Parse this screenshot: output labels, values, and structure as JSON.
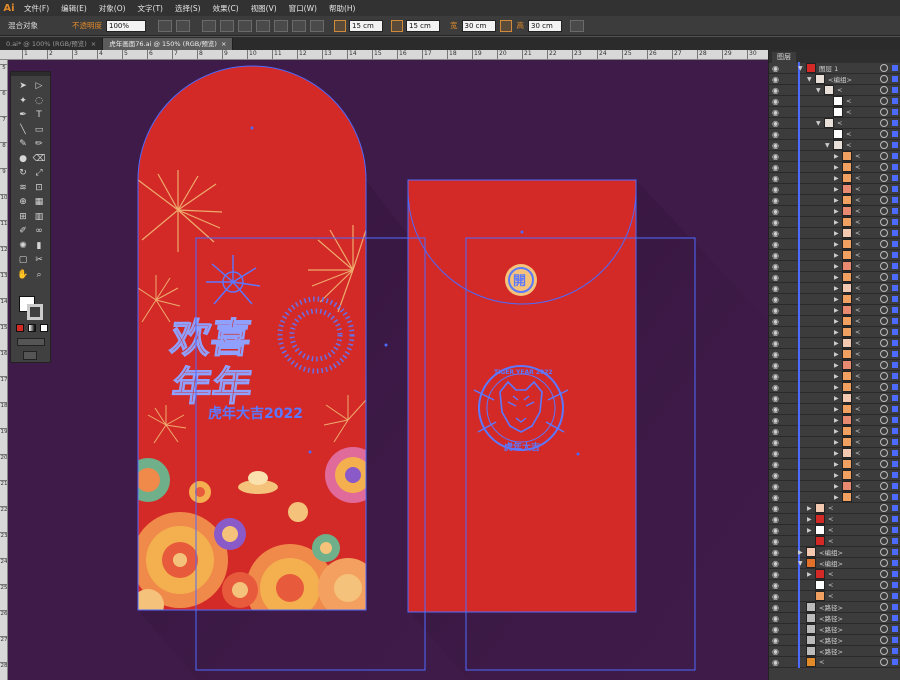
{
  "app": {
    "logo": "Ai"
  },
  "menu": [
    "文件(F)",
    "编辑(E)",
    "对象(O)",
    "文字(T)",
    "选择(S)",
    "效果(C)",
    "视图(V)",
    "窗口(W)",
    "帮助(H)"
  ],
  "control_bar": {
    "mode_label": "混合对象",
    "opacity_label": "不透明度",
    "opacity_value": "100%",
    "w_label": "宽",
    "x_value": "15 cm",
    "y_value": "15 cm",
    "w_value": "30 cm",
    "h_label": "高",
    "h_value": "30 cm"
  },
  "tabs": [
    {
      "label": "0.ai* @ 100% (RGB/预览)",
      "close": "×",
      "active": false
    },
    {
      "label": "虎年画面76.ai @ 150% (RGB/预览)",
      "close": "×",
      "active": true
    }
  ],
  "ruler_top": [
    "1",
    "2",
    "3",
    "4",
    "5",
    "6",
    "7",
    "8",
    "9",
    "10",
    "11",
    "12",
    "13",
    "14",
    "15",
    "16",
    "17",
    "18",
    "19",
    "20",
    "21",
    "22",
    "23",
    "24",
    "25",
    "26",
    "27",
    "28",
    "29",
    "30",
    "31"
  ],
  "ruler_left": [
    "5",
    "6",
    "7",
    "8",
    "9",
    "10",
    "11",
    "12",
    "13",
    "14",
    "15",
    "16",
    "17",
    "18",
    "19",
    "20",
    "21",
    "22",
    "23",
    "24",
    "25",
    "26",
    "27",
    "28"
  ],
  "artwork": {
    "title_line1": "欢喜",
    "title_line2": "年年",
    "badge_year": "虎年大吉2022",
    "seal_char": "開",
    "tiger_badge_top": "TIGER YEAR 2022",
    "tiger_badge_bottom": "虎年大吉",
    "colors": {
      "red": "#d32a27",
      "purple": "#3f1b49",
      "gold": "#f4c27a",
      "blue": "#5c78ff",
      "selection": "#4d6aff"
    }
  },
  "toolbox": {
    "icons": [
      "selection-icon",
      "direct-select-icon",
      "magic-wand-icon",
      "lasso-icon",
      "pen-icon",
      "type-icon",
      "line-icon",
      "rect-icon",
      "brush-icon",
      "pencil-icon",
      "blob-brush-icon",
      "eraser-icon",
      "rotate-icon",
      "scale-icon",
      "width-icon",
      "free-transform-icon",
      "shape-builder-icon",
      "perspective-icon",
      "mesh-icon",
      "gradient-icon",
      "eyedropper-icon",
      "blend-icon",
      "symbol-sprayer-icon",
      "graph-icon",
      "artboard-icon",
      "slice-icon",
      "hand-icon",
      "zoom-icon"
    ]
  },
  "layers": {
    "panel_title": "图层",
    "rows": [
      {
        "name": "图层 1",
        "indent": 1,
        "tri": "▼",
        "thumb": "#d32a27"
      },
      {
        "name": "<编组>",
        "indent": 2,
        "tri": "▼",
        "thumb": "#e8e0d8"
      },
      {
        "name": "<",
        "indent": 3,
        "tri": "▼",
        "thumb": "#e8e0d8"
      },
      {
        "name": "<",
        "indent": 4,
        "tri": "",
        "thumb": "#ffffff"
      },
      {
        "name": "<",
        "indent": 4,
        "tri": "",
        "thumb": "#ffffff"
      },
      {
        "name": "<",
        "indent": 3,
        "tri": "▼",
        "thumb": "#e8e0d8"
      },
      {
        "name": "<",
        "indent": 4,
        "tri": "",
        "thumb": "#ffffff"
      },
      {
        "name": "<",
        "indent": 4,
        "tri": "▼",
        "thumb": "#e8e0d8"
      },
      {
        "name": "<",
        "indent": 5,
        "tri": "▶",
        "thumb": "#f0a060"
      },
      {
        "name": "<",
        "indent": 5,
        "tri": "▶",
        "thumb": "#f0a060"
      },
      {
        "name": "<",
        "indent": 5,
        "tri": "▶",
        "thumb": "#f0a060"
      },
      {
        "name": "<",
        "indent": 5,
        "tri": "▶",
        "thumb": "#e88a70"
      },
      {
        "name": "<",
        "indent": 5,
        "tri": "▶",
        "thumb": "#f0a060"
      },
      {
        "name": "<",
        "indent": 5,
        "tri": "▶",
        "thumb": "#e88a70"
      },
      {
        "name": "<",
        "indent": 5,
        "tri": "▶",
        "thumb": "#f0a060"
      },
      {
        "name": "<",
        "indent": 5,
        "tri": "▶",
        "thumb": "#f2c9b0"
      },
      {
        "name": "<",
        "indent": 5,
        "tri": "▶",
        "thumb": "#f0a060"
      },
      {
        "name": "<",
        "indent": 5,
        "tri": "▶",
        "thumb": "#f0a060"
      },
      {
        "name": "<",
        "indent": 5,
        "tri": "▶",
        "thumb": "#e88a70"
      },
      {
        "name": "<",
        "indent": 5,
        "tri": "▶",
        "thumb": "#f0a060"
      },
      {
        "name": "<",
        "indent": 5,
        "tri": "▶",
        "thumb": "#f2c9b0"
      },
      {
        "name": "<",
        "indent": 5,
        "tri": "▶",
        "thumb": "#f0a060"
      },
      {
        "name": "<",
        "indent": 5,
        "tri": "▶",
        "thumb": "#e88a70"
      },
      {
        "name": "<",
        "indent": 5,
        "tri": "▶",
        "thumb": "#f0a060"
      },
      {
        "name": "<",
        "indent": 5,
        "tri": "▶",
        "thumb": "#f0a060"
      },
      {
        "name": "<",
        "indent": 5,
        "tri": "▶",
        "thumb": "#f2c9b0"
      },
      {
        "name": "<",
        "indent": 5,
        "tri": "▶",
        "thumb": "#f0a060"
      },
      {
        "name": "<",
        "indent": 5,
        "tri": "▶",
        "thumb": "#e88a70"
      },
      {
        "name": "<",
        "indent": 5,
        "tri": "▶",
        "thumb": "#f0a060"
      },
      {
        "name": "<",
        "indent": 5,
        "tri": "▶",
        "thumb": "#f0a060"
      },
      {
        "name": "<",
        "indent": 5,
        "tri": "▶",
        "thumb": "#f2c9b0"
      },
      {
        "name": "<",
        "indent": 5,
        "tri": "▶",
        "thumb": "#f0a060"
      },
      {
        "name": "<",
        "indent": 5,
        "tri": "▶",
        "thumb": "#e88a70"
      },
      {
        "name": "<",
        "indent": 5,
        "tri": "▶",
        "thumb": "#f0a060"
      },
      {
        "name": "<",
        "indent": 5,
        "tri": "▶",
        "thumb": "#f0a060"
      },
      {
        "name": "<",
        "indent": 5,
        "tri": "▶",
        "thumb": "#f2c9b0"
      },
      {
        "name": "<",
        "indent": 5,
        "tri": "▶",
        "thumb": "#f0a060"
      },
      {
        "name": "<",
        "indent": 5,
        "tri": "▶",
        "thumb": "#f0a060"
      },
      {
        "name": "<",
        "indent": 5,
        "tri": "▶",
        "thumb": "#e88a70"
      },
      {
        "name": "<",
        "indent": 5,
        "tri": "▶",
        "thumb": "#f0a060"
      },
      {
        "name": "<",
        "indent": 2,
        "tri": "▶",
        "thumb": "#f2c9b0"
      },
      {
        "name": "<",
        "indent": 2,
        "tri": "▶",
        "thumb": "#d32a27"
      },
      {
        "name": "<",
        "indent": 2,
        "tri": "▶",
        "thumb": "#ffffff"
      },
      {
        "name": "<",
        "indent": 2,
        "tri": "",
        "thumb": "#d32a27"
      },
      {
        "name": "<编组>",
        "indent": 1,
        "tri": "▶",
        "thumb": "#f2c9b0"
      },
      {
        "name": "<编组>",
        "indent": 1,
        "tri": "▼",
        "thumb": "#e0702a"
      },
      {
        "name": "<",
        "indent": 2,
        "tri": "▶",
        "thumb": "#d32a27"
      },
      {
        "name": "<",
        "indent": 2,
        "tri": "",
        "thumb": "#ffffff"
      },
      {
        "name": "<",
        "indent": 2,
        "tri": "",
        "thumb": "#f0a060"
      },
      {
        "name": "<路径>",
        "indent": 1,
        "tri": "",
        "thumb": "#bbbbbb"
      },
      {
        "name": "<路径>",
        "indent": 1,
        "tri": "",
        "thumb": "#bbbbbb"
      },
      {
        "name": "<路径>",
        "indent": 1,
        "tri": "",
        "thumb": "#bbbbbb"
      },
      {
        "name": "<路径>",
        "indent": 1,
        "tri": "",
        "thumb": "#bbbbbb"
      },
      {
        "name": "<路径>",
        "indent": 1,
        "tri": "",
        "thumb": "#bbbbbb"
      },
      {
        "name": "<",
        "indent": 1,
        "tri": "",
        "thumb": "#e08a2a"
      }
    ]
  }
}
